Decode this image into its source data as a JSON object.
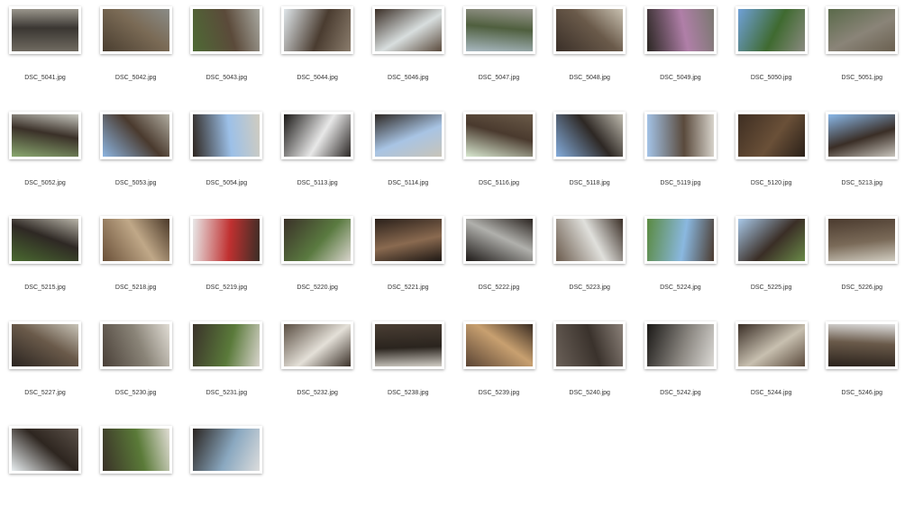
{
  "files": [
    {
      "name": "DSC_5041.jpg",
      "tones": [
        "#6f6a60",
        "#3a3632",
        "#9a968c"
      ]
    },
    {
      "name": "DSC_5042.jpg",
      "tones": [
        "#4a3e30",
        "#7a6a55",
        "#8a8c88"
      ]
    },
    {
      "name": "DSC_5043.jpg",
      "tones": [
        "#4e6a35",
        "#5b4a3a",
        "#a8a8a0"
      ]
    },
    {
      "name": "DSC_5044.jpg",
      "tones": [
        "#dfe6ea",
        "#4a3c30",
        "#8a7c6c"
      ]
    },
    {
      "name": "DSC_5046.jpg",
      "tones": [
        "#3a2e26",
        "#d8dede",
        "#5a4a3c"
      ]
    },
    {
      "name": "DSC_5047.jpg",
      "tones": [
        "#a8b8c0",
        "#4f5f3e",
        "#9a9890"
      ]
    },
    {
      "name": "DSC_5048.jpg",
      "tones": [
        "#3a2f28",
        "#6a5a4a",
        "#c8c0b0"
      ]
    },
    {
      "name": "DSC_5049.jpg",
      "tones": [
        "#2a2622",
        "#b07fa8",
        "#7a7870"
      ]
    },
    {
      "name": "DSC_5050.jpg",
      "tones": [
        "#6fa0d8",
        "#3f6a30",
        "#8a8a80"
      ]
    },
    {
      "name": "DSC_5051.jpg",
      "tones": [
        "#5a6a4a",
        "#8a8478",
        "#6a6050"
      ]
    },
    {
      "name": "DSC_5052.jpg",
      "tones": [
        "#8aa870",
        "#3a3028",
        "#c8c8c0"
      ]
    },
    {
      "name": "DSC_5053.jpg",
      "tones": [
        "#8cb4e0",
        "#4a3a2e",
        "#b0aca0"
      ]
    },
    {
      "name": "DSC_5054.jpg",
      "tones": [
        "#2e2620",
        "#9cc0e8",
        "#d0ccc0"
      ]
    },
    {
      "name": "DSC_5113.jpg",
      "tones": [
        "#1a1816",
        "#e8e8e8",
        "#2a2624"
      ]
    },
    {
      "name": "DSC_5114.jpg",
      "tones": [
        "#2e2824",
        "#a8c4e4",
        "#c8c4b8"
      ]
    },
    {
      "name": "DSC_5116.jpg",
      "tones": [
        "#d8e8d0",
        "#4a3a2e",
        "#6a5a48"
      ]
    },
    {
      "name": "DSC_5118.jpg",
      "tones": [
        "#84acdc",
        "#2e2824",
        "#c0bcb0"
      ]
    },
    {
      "name": "DSC_5119.jpg",
      "tones": [
        "#a4c4e8",
        "#5a4a3c",
        "#d8d4cc"
      ]
    },
    {
      "name": "DSC_5120.jpg",
      "tones": [
        "#3e2e22",
        "#6a5038",
        "#2a2018"
      ]
    },
    {
      "name": "DSC_5213.jpg",
      "tones": [
        "#8ab8e8",
        "#3a2e26",
        "#c8c4bc"
      ]
    },
    {
      "name": "DSC_5215.jpg",
      "tones": [
        "#4a6a30",
        "#2e2824",
        "#b8b4a8"
      ]
    },
    {
      "name": "DSC_5218.jpg",
      "tones": [
        "#6a5038",
        "#c0a888",
        "#4a3828"
      ]
    },
    {
      "name": "DSC_5219.jpg",
      "tones": [
        "#e8e8e8",
        "#c03030",
        "#3a2e26"
      ]
    },
    {
      "name": "DSC_5220.jpg",
      "tones": [
        "#3a3028",
        "#5a7a40",
        "#d8d4cc"
      ]
    },
    {
      "name": "DSC_5221.jpg",
      "tones": [
        "#2a201a",
        "#8a6a50",
        "#1e1814"
      ]
    },
    {
      "name": "DSC_5222.jpg",
      "tones": [
        "#1e1a18",
        "#b0b0ac",
        "#2a2420"
      ]
    },
    {
      "name": "DSC_5223.jpg",
      "tones": [
        "#6a5a4c",
        "#e0e0dc",
        "#3a2e26"
      ]
    },
    {
      "name": "DSC_5224.jpg",
      "tones": [
        "#5a8a40",
        "#8ab8e0",
        "#4a3a2e"
      ]
    },
    {
      "name": "DSC_5225.jpg",
      "tones": [
        "#a8c8e8",
        "#3a2e26",
        "#6a8a48"
      ]
    },
    {
      "name": "DSC_5226.jpg",
      "tones": [
        "#4a3a2e",
        "#7a6a58",
        "#d0ccc0"
      ]
    },
    {
      "name": "DSC_5227.jpg",
      "tones": [
        "#2a2420",
        "#6a5a4a",
        "#c8c4b8"
      ]
    },
    {
      "name": "DSC_5230.jpg",
      "tones": [
        "#4a4038",
        "#8a8478",
        "#e0dcd4"
      ]
    },
    {
      "name": "DSC_5231.jpg",
      "tones": [
        "#3a322a",
        "#5a7a3a",
        "#d8d4cc"
      ]
    },
    {
      "name": "DSC_5232.jpg",
      "tones": [
        "#5a4e42",
        "#e4e0d8",
        "#3a3028"
      ]
    },
    {
      "name": "DSC_5238.jpg",
      "tones": [
        "#4a3e34",
        "#2a241e",
        "#d0ccc4"
      ]
    },
    {
      "name": "DSC_5239.jpg",
      "tones": [
        "#5a4434",
        "#c8a070",
        "#3a2c22"
      ]
    },
    {
      "name": "DSC_5240.jpg",
      "tones": [
        "#6a6058",
        "#3a322c",
        "#8a8078"
      ]
    },
    {
      "name": "DSC_5242.jpg",
      "tones": [
        "#1a1816",
        "#8a8680",
        "#dcdad6"
      ]
    },
    {
      "name": "DSC_5244.jpg",
      "tones": [
        "#3a2e26",
        "#c8c0b0",
        "#5a4a3c"
      ]
    },
    {
      "name": "DSC_5246.jpg",
      "tones": [
        "#2a221c",
        "#6a5a4a",
        "#e0e0e0"
      ]
    },
    {
      "name": "",
      "tones": [
        "#e8eef0",
        "#2e2620",
        "#5a5048"
      ]
    },
    {
      "name": "",
      "tones": [
        "#3a3228",
        "#5a7a38",
        "#e0dcd4"
      ]
    },
    {
      "name": "",
      "tones": [
        "#2a2420",
        "#8aa8c0",
        "#dcdcdc"
      ]
    }
  ]
}
